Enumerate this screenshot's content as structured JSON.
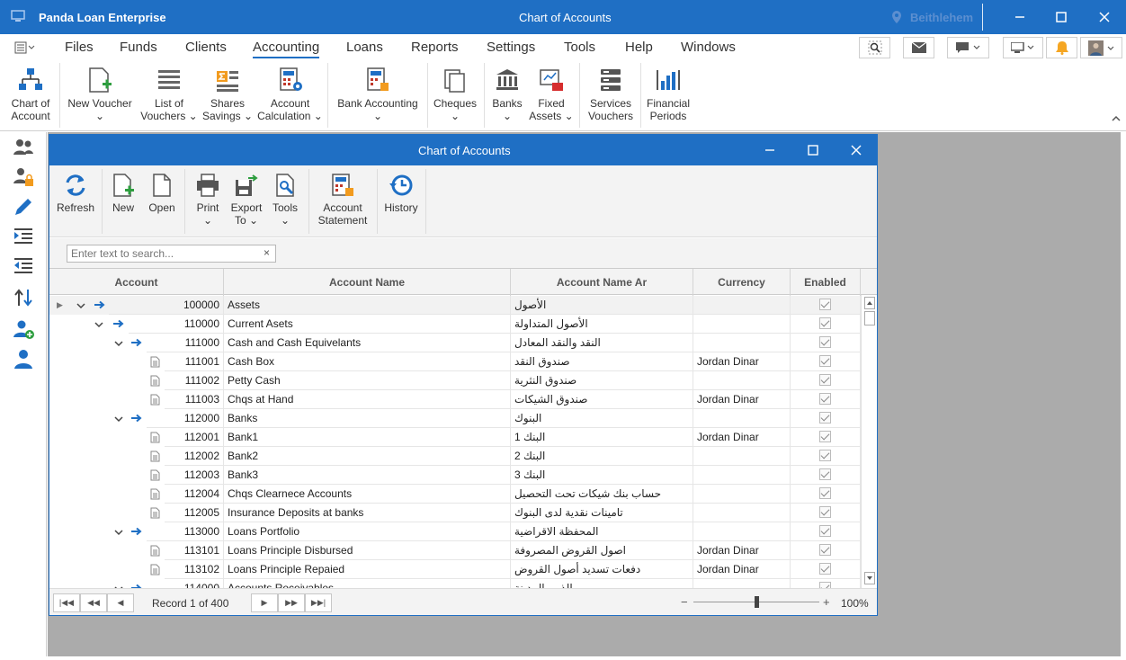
{
  "app": {
    "title": "Panda Loan Enterprise",
    "document_title": "Chart of Accounts",
    "location": "Beithlehem",
    "accent": "#1f6fc4"
  },
  "menu": [
    "Files",
    "Funds",
    "Clients",
    "Accounting",
    "Loans",
    "Reports",
    "Settings",
    "Tools",
    "Help",
    "Windows"
  ],
  "menu_active": "Accounting",
  "ribbon": [
    {
      "label1": "Chart of",
      "label2": "Account",
      "icon": "org-chart-icon"
    },
    {
      "label1": "New Voucher",
      "label2": "⌄",
      "icon": "new-doc-icon"
    },
    {
      "label1": "List of",
      "label2": "Vouchers ⌄",
      "icon": "list-icon"
    },
    {
      "label1": "Shares",
      "label2": "Savings ⌄",
      "icon": "sigma-icon"
    },
    {
      "label1": "Account",
      "label2": "Calculation ⌄",
      "icon": "calculator-icon"
    },
    {
      "label1": "Bank Accounting",
      "label2": "⌄",
      "icon": "bank-calc-icon"
    },
    {
      "label1": "Cheques",
      "label2": "⌄",
      "icon": "cheques-icon"
    },
    {
      "label1": "Banks",
      "label2": "⌄",
      "icon": "bank-icon"
    },
    {
      "label1": "Fixed",
      "label2": "Assets ⌄",
      "icon": "fixed-assets-icon"
    },
    {
      "label1": "Services",
      "label2": "Vouchers",
      "icon": "services-icon"
    },
    {
      "label1": "Financial",
      "label2": "Periods",
      "icon": "periods-icon"
    }
  ],
  "child": {
    "title": "Chart of Accounts",
    "toolbar": [
      {
        "label1": "Refresh",
        "label2": ""
      },
      {
        "label1": "New",
        "label2": ""
      },
      {
        "label1": "Open",
        "label2": ""
      },
      {
        "label1": "Print",
        "label2": "⌄"
      },
      {
        "label1": "Export",
        "label2": "To ⌄"
      },
      {
        "label1": "Tools",
        "label2": "⌄"
      },
      {
        "label1": "Account",
        "label2": "Statement"
      },
      {
        "label1": "History",
        "label2": ""
      }
    ],
    "search_placeholder": "Enter text to search...",
    "columns": [
      "Account",
      "Account Name",
      "Account Name Ar",
      "Currency",
      "Enabled"
    ],
    "rows": [
      {
        "level": 0,
        "type": "group",
        "code": "100000",
        "name": "Assets",
        "name_ar": "الأصول",
        "currency": "",
        "enabled": true
      },
      {
        "level": 1,
        "type": "group",
        "code": "110000",
        "name": "Current Asets",
        "name_ar": "الأصول المتداولة",
        "currency": "",
        "enabled": true
      },
      {
        "level": 2,
        "type": "group",
        "code": "111000",
        "name": "Cash and Cash Equivelants",
        "name_ar": "النقد والنقد المعادل",
        "currency": "",
        "enabled": true
      },
      {
        "level": 3,
        "type": "leaf",
        "code": "111001",
        "name": "Cash Box",
        "name_ar": "صندوق النقد",
        "currency": "Jordan Dinar",
        "enabled": true
      },
      {
        "level": 3,
        "type": "leaf",
        "code": "111002",
        "name": "Petty Cash",
        "name_ar": "صندوق النثرية",
        "currency": "",
        "enabled": true
      },
      {
        "level": 3,
        "type": "leaf",
        "code": "111003",
        "name": "Chqs at Hand",
        "name_ar": "صندوق الشيكات",
        "currency": "Jordan Dinar",
        "enabled": true
      },
      {
        "level": 2,
        "type": "group",
        "code": "112000",
        "name": "Banks",
        "name_ar": "البنوك",
        "currency": "",
        "enabled": true
      },
      {
        "level": 3,
        "type": "leaf",
        "code": "112001",
        "name": "Bank1",
        "name_ar": "البنك 1",
        "currency": "Jordan Dinar",
        "enabled": true
      },
      {
        "level": 3,
        "type": "leaf",
        "code": "112002",
        "name": "Bank2",
        "name_ar": "البنك 2",
        "currency": "",
        "enabled": true
      },
      {
        "level": 3,
        "type": "leaf",
        "code": "112003",
        "name": "Bank3",
        "name_ar": "البنك 3",
        "currency": "",
        "enabled": true
      },
      {
        "level": 3,
        "type": "leaf",
        "code": "112004",
        "name": "Chqs Clearnece Accounts",
        "name_ar": "حساب بنك شيكات تحت التحصيل",
        "currency": "",
        "enabled": true
      },
      {
        "level": 3,
        "type": "leaf",
        "code": "112005",
        "name": "Insurance Deposits at banks",
        "name_ar": "تامينات نقدية لدى البنوك",
        "currency": "",
        "enabled": true
      },
      {
        "level": 2,
        "type": "group",
        "code": "113000",
        "name": "Loans Portfolio",
        "name_ar": "المحفظة الاقراضية",
        "currency": "",
        "enabled": true
      },
      {
        "level": 3,
        "type": "leaf",
        "code": "113101",
        "name": "Loans Principle Disbursed",
        "name_ar": "اصول القروض المصروفة",
        "currency": "Jordan Dinar",
        "enabled": true
      },
      {
        "level": 3,
        "type": "leaf",
        "code": "113102",
        "name": "Loans Principle Repaied",
        "name_ar": "دفعات تسديد أصول القروض",
        "currency": "Jordan Dinar",
        "enabled": true
      },
      {
        "level": 2,
        "type": "group",
        "code": "114000",
        "name": "Accounts Receivables",
        "name_ar": "الذمم المدينة",
        "currency": "",
        "enabled": true
      }
    ],
    "record_text": "Record 1 of 400",
    "zoom_text": "100%",
    "zoom_level": 0.5
  }
}
